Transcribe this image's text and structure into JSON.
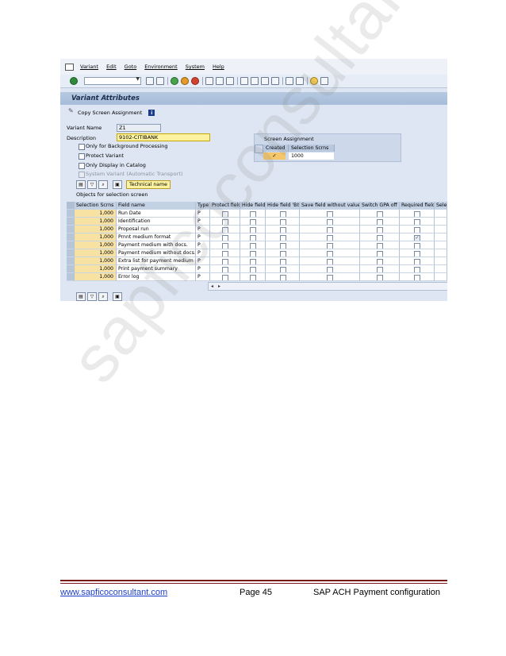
{
  "menu": [
    "Variant",
    "Edit",
    "Goto",
    "Environment",
    "System",
    "Help"
  ],
  "window_title": "Variant Attributes",
  "app_toolbar": {
    "copy_screen_assignment": "Copy Screen Assignment"
  },
  "form": {
    "variant_name_label": "Variant Name",
    "variant_name_value": "Z1",
    "description_label": "Description",
    "description_value": "9102-CITIBANK",
    "checkboxes": [
      {
        "label": "Only for Background Processing",
        "checked": false,
        "disabled": false
      },
      {
        "label": "Protect Variant",
        "checked": false,
        "disabled": false
      },
      {
        "label": "Only Display in Catalog",
        "checked": false,
        "disabled": false
      },
      {
        "label": "System Variant (Automatic Transport)",
        "checked": false,
        "disabled": true
      }
    ]
  },
  "screen_assignment": {
    "title": "Screen Assignment",
    "col_created": "Created",
    "col_selection_scrns": "Selection Scrns",
    "created_checked": true,
    "created_mark": "✓",
    "selection_scrn_value": "1000"
  },
  "table_tools": {
    "technical_name": "Technical name"
  },
  "objects_label": "Objects for selection screen",
  "columns": [
    "Selection Scrns",
    "Field name",
    "Type",
    "Protect field",
    "Hide field",
    "Hide field 'BIS'",
    "Save field without values",
    "Switch GPA off",
    "Required field",
    "Selec"
  ],
  "rows": [
    {
      "scrn": "1,000",
      "field": "Run Date",
      "type": "P",
      "required": false
    },
    {
      "scrn": "1,000",
      "field": "Identification",
      "type": "P",
      "required": false
    },
    {
      "scrn": "1,000",
      "field": "Proposal run",
      "type": "P",
      "required": false
    },
    {
      "scrn": "1,000",
      "field": "Prnnt medium format",
      "type": "P",
      "required": true
    },
    {
      "scrn": "1,000",
      "field": "Payment medium with docs.",
      "type": "P",
      "required": false
    },
    {
      "scrn": "1,000",
      "field": "Payment medium without docs.",
      "type": "P",
      "required": false
    },
    {
      "scrn": "1,000",
      "field": "Extra list for payment medium",
      "type": "P",
      "required": false
    },
    {
      "scrn": "1,000",
      "field": "Print payment summary",
      "type": "P",
      "required": false
    },
    {
      "scrn": "1,000",
      "field": "Error log",
      "type": "P",
      "required": false
    }
  ],
  "required_mark": "✓",
  "footer": {
    "link": "www.sapficoconsultant.com",
    "page": "Page 45",
    "title": "SAP ACH Payment configuration"
  },
  "watermark": "sapficoconsultant"
}
